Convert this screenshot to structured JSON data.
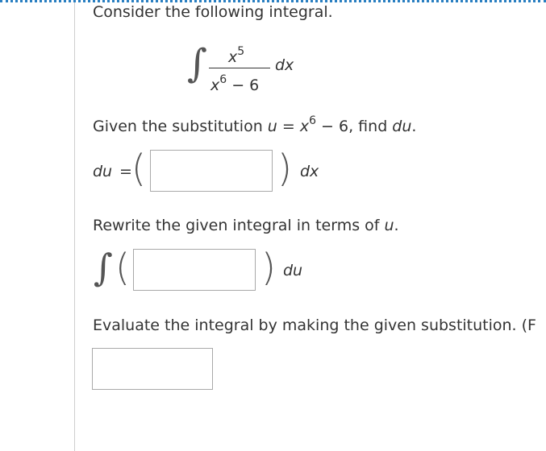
{
  "question": {
    "intro": "Consider the following integral.",
    "integrand": {
      "numerator_base": "x",
      "numerator_exp": "5",
      "denominator_base": "x",
      "denominator_exp": "6",
      "denominator_rest": " − 6",
      "differential": "dx"
    },
    "step1": {
      "prompt_prefix": "Given the substitution ",
      "u_var": "u",
      "equals": " = ",
      "x_var": "x",
      "x_exp": "6",
      "prompt_middle": " − 6, find ",
      "du_text": "du",
      "prompt_suffix": ".",
      "lhs": "du",
      "lhs_eq": "=",
      "answer_value": "",
      "differential": "dx"
    },
    "step2": {
      "prompt": "Rewrite the given integral in terms of ",
      "u_var": "u",
      "prompt_suffix": ".",
      "answer_value": "",
      "differential": "du"
    },
    "step3": {
      "prompt": "Evaluate the integral by making the given substitution. (F",
      "answer_value": ""
    }
  }
}
